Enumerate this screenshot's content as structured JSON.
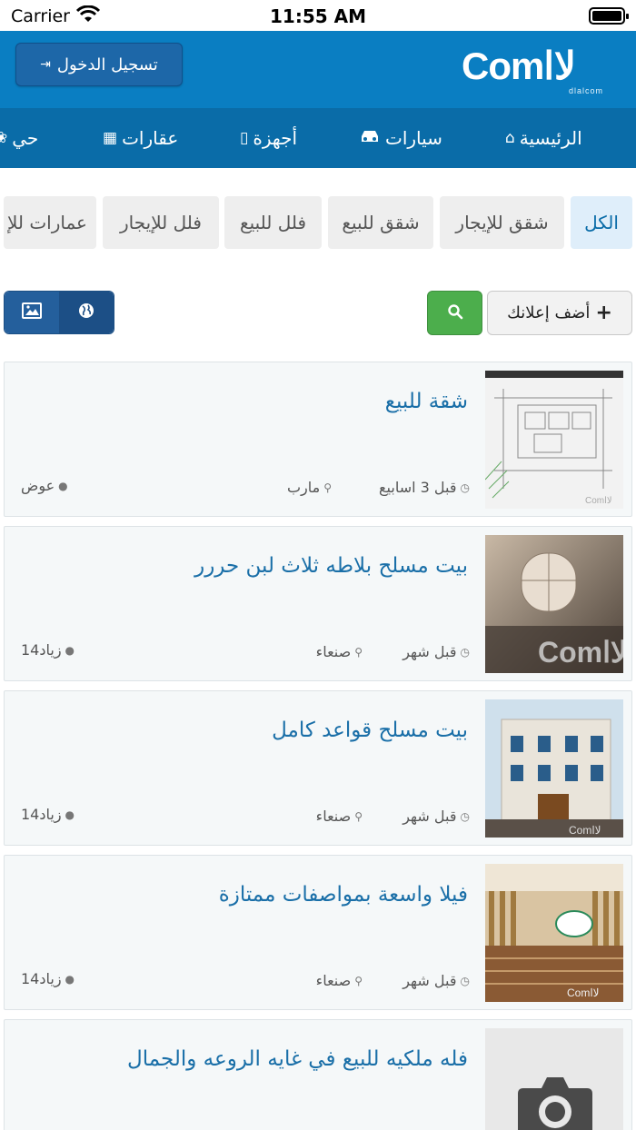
{
  "status_bar": {
    "carrier": "Carrier",
    "time": "11:55 AM"
  },
  "header": {
    "login_label": "تسجيل الدخول",
    "logo_text": "Comلاا",
    "logo_subtext": "dlalcom"
  },
  "nav": {
    "items": [
      {
        "label": "الرئيسية",
        "icon": "home-icon"
      },
      {
        "label": "سيارات",
        "icon": "car-icon"
      },
      {
        "label": "أجهزة",
        "icon": "mobile-icon"
      },
      {
        "label": "عقارات",
        "icon": "building-icon"
      },
      {
        "label": "حي",
        "icon": "paw-icon"
      }
    ]
  },
  "categories": {
    "items": [
      {
        "label": "الكل",
        "active": true
      },
      {
        "label": "شقق للإيجار",
        "active": false
      },
      {
        "label": "شقق للبيع",
        "active": false
      },
      {
        "label": "فلل للبيع",
        "active": false
      },
      {
        "label": "فلل للإيجار",
        "active": false
      },
      {
        "label": "عمارات للإ",
        "active": false
      }
    ]
  },
  "toolbar": {
    "add_label": "أضف إعلانك"
  },
  "listings": [
    {
      "title": "شقة للبيع",
      "time": "قبل 3 اسابيع",
      "location": "مارب",
      "user": "عوض"
    },
    {
      "title": "بيت مسلح بلاطه ثلاث لبن حررر",
      "time": "قبل شهر",
      "location": "صنعاء",
      "user": "زياد14"
    },
    {
      "title": "بيت مسلح قواعد كامل",
      "time": "قبل شهر",
      "location": "صنعاء",
      "user": "زياد14"
    },
    {
      "title": "فيلا واسعة بمواصفات ممتازة",
      "time": "قبل شهر",
      "location": "صنعاء",
      "user": "زياد14"
    },
    {
      "title": "فله ملكيه للبيع في غايه الروعه والجمال",
      "time": "",
      "location": "",
      "user": ""
    }
  ],
  "colors": {
    "header": "#0a7ec2",
    "nav": "#0a6ca8",
    "title": "#1a6fa8",
    "search": "#4cae4c"
  }
}
